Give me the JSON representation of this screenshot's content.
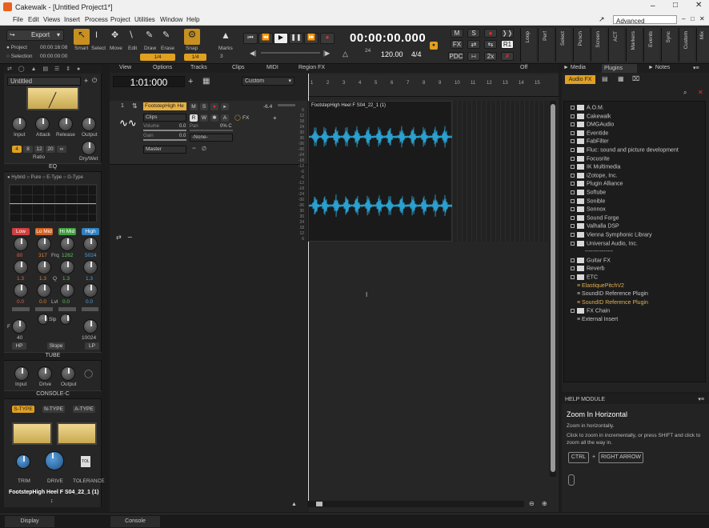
{
  "window": {
    "title": "Cakewalk - [Untitled Project1*]"
  },
  "menu": [
    "File",
    "Edit",
    "Views",
    "Insert",
    "Process",
    "Project",
    "Utilities",
    "Window",
    "Help"
  ],
  "workspace": {
    "selected": "Advanced"
  },
  "control_bar": {
    "export_label": "Export",
    "project_label": "Project",
    "selection_label": "Selection",
    "project_time": "00:00:16:08",
    "selection_time": "00:00:00:00",
    "tools": [
      "Smart",
      "Select",
      "Move",
      "Edit",
      "Draw",
      "Erase"
    ],
    "snap_label": "Snap",
    "snap_value": "1/4",
    "marks_label": "Marks",
    "marks_value": "3",
    "time": "00:00:00.000",
    "tempo": "120.00",
    "meter": "4/4",
    "meter_top": "24",
    "mix_labels": {
      "m": "M",
      "s": "S",
      "fx": "FX",
      "pdc": "PDC",
      "two_x": "2x",
      "r1": "R1"
    },
    "vertical_tabs": [
      "Loop",
      "Perf",
      "Select",
      "Punch",
      "Screen",
      "ACT",
      "Markers",
      "Events",
      "Sync",
      "Custom",
      "Mix"
    ]
  },
  "inspector": {
    "track_name": "Untitled",
    "comp_knobs": [
      "Input",
      "Attack",
      "Release",
      "Output"
    ],
    "ratio_buttons": [
      "4",
      "8",
      "12",
      "20",
      "∞"
    ],
    "ratio_label": "Ratio",
    "dry_wet_label": "Dry/Wet",
    "eq_label": "EQ",
    "eq_modes": [
      "Hybrid",
      "Pure",
      "E-Type",
      "G-Type"
    ],
    "eq_bands": [
      "Low",
      "Lo Mid",
      "Hi Mid",
      "High"
    ],
    "freq_values": [
      "80",
      "317",
      "1262",
      "5024"
    ],
    "freq_label": "Frq",
    "q_values": [
      "1.3",
      "1.3",
      "1.3",
      "1.3"
    ],
    "q_label": "Q",
    "gain_values": [
      "0.0",
      "0.0",
      "0.0",
      "0.0"
    ],
    "lvl_label": "Lvl",
    "slp_label": "Slp",
    "hp_value": "40",
    "lp_value": "10024",
    "hp_label": "HP",
    "lp_label": "LP",
    "slope_label": "Slope",
    "f_label": "F",
    "tube_label": "TUBE",
    "tube_knobs": [
      "Input",
      "Drive",
      "Output"
    ],
    "console_label": "CONSOLE-C",
    "console_types": [
      "S-TYPE",
      "N-TYPE",
      "A-TYPE"
    ],
    "console_knobs": [
      "TRIM",
      "DRIVE",
      "TOLERANCE"
    ],
    "tol_label": "TOL",
    "clip_name": "FootstepHigh Heel F S04_22_1 (1)"
  },
  "track_view": {
    "menus": [
      "View",
      "Options",
      "Tracks",
      "Clips",
      "MIDI",
      "Region FX"
    ],
    "now_time": "1:01:000",
    "custom_label": "Custom",
    "off_label": "Off",
    "track": {
      "number": "1",
      "name": "FootstepHigh He",
      "volume_label": "Volume",
      "volume_value": "0.0",
      "pan_label": "Pan",
      "pan_value": "0% C",
      "gain_label": "Gain",
      "gain_value": "0.0",
      "clips_label": "Clips",
      "input_label": "-None-",
      "output_label": "Master",
      "level": "-6.4",
      "fx_label": "FX",
      "buttons": [
        "M",
        "S",
        "R",
        "W",
        "A"
      ]
    },
    "ruler": [
      "1",
      "2",
      "3",
      "4",
      "5",
      "6",
      "7",
      "8",
      "9",
      "10",
      "11",
      "12",
      "13",
      "14",
      "15"
    ],
    "db_scale": [
      "6",
      "12",
      "18",
      "24",
      "30",
      "36",
      "-36",
      "-30",
      "-24",
      "-18",
      "-12",
      "-6",
      "-6",
      "-12",
      "-18",
      "-24",
      "-30",
      "-36",
      "36",
      "30",
      "24",
      "18",
      "12",
      "6"
    ],
    "clip_label": "FootstepHigh Heel F S04_22_1 (1)"
  },
  "browser": {
    "tabs": [
      "Media",
      "Plugins",
      "Notes"
    ],
    "active_tab": "Plugins",
    "category": "Audio FX",
    "items": [
      {
        "label": "A.O.M.",
        "type": "folder"
      },
      {
        "label": "Cakewalk",
        "type": "folder"
      },
      {
        "label": "DMGAudio",
        "type": "folder"
      },
      {
        "label": "Eventide",
        "type": "folder"
      },
      {
        "label": "FabFilter",
        "type": "folder"
      },
      {
        "label": "Fluc: sound and picture development",
        "type": "folder"
      },
      {
        "label": "Focusrite",
        "type": "folder"
      },
      {
        "label": "IK Multimedia",
        "type": "folder"
      },
      {
        "label": "iZotope, Inc.",
        "type": "folder"
      },
      {
        "label": "Plugin Alliance",
        "type": "folder"
      },
      {
        "label": "Softube",
        "type": "folder"
      },
      {
        "label": "Sonible",
        "type": "folder"
      },
      {
        "label": "Sonnox",
        "type": "folder"
      },
      {
        "label": "Sound Forge",
        "type": "folder"
      },
      {
        "label": "Valhalla DSP",
        "type": "folder"
      },
      {
        "label": "Vienna Symphonic Library",
        "type": "folder"
      },
      {
        "label": "Universal Audio, Inc.",
        "type": "folder"
      },
      {
        "label": "---------------",
        "type": "sep"
      },
      {
        "label": "Guitar FX",
        "type": "folder"
      },
      {
        "label": "Reverb",
        "type": "folder"
      },
      {
        "label": "ETC",
        "type": "folder"
      },
      {
        "label": "ElastiquePitchV2",
        "type": "plugin-hl"
      },
      {
        "label": "SoundID Reference Plugin",
        "type": "plugin"
      },
      {
        "label": "SoundID Reference Plugin",
        "type": "plugin-hl"
      },
      {
        "label": "FX Chain",
        "type": "folder"
      },
      {
        "label": "External Insert",
        "type": "plugin"
      }
    ]
  },
  "help": {
    "header": "HELP MODULE",
    "title": "Zoom In Horizontal",
    "line1": "Zoom in horizontally.",
    "line2": "Click to zoom in incrementally, or press SHIFT and click to zoom all the way in.",
    "key1": "CTRL",
    "plus": "+",
    "key2": "RIGHT ARROW"
  },
  "bottom": {
    "display": "Display",
    "console": "Console"
  }
}
